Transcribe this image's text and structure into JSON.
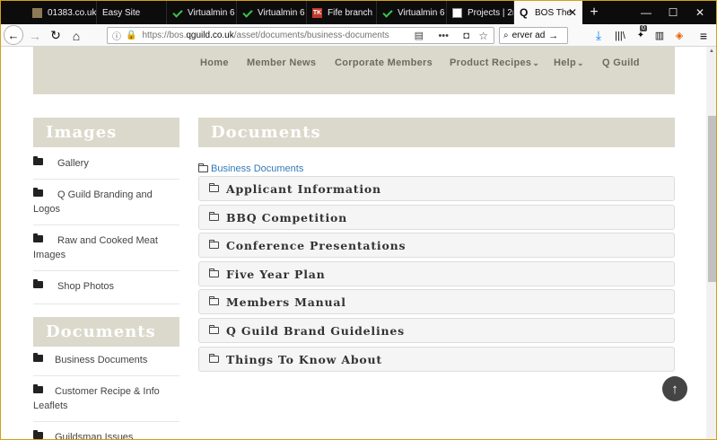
{
  "browser": {
    "tabs": [
      {
        "label": "01383.co.uk",
        "icon": "photo-icon"
      },
      {
        "label": "Easy Site",
        "icon": ""
      },
      {
        "label": "Virtualmin 6",
        "icon": "check-icon"
      },
      {
        "label": "Virtualmin 6",
        "icon": "check-icon"
      },
      {
        "label": "Fife branch",
        "icon": "tk-icon"
      },
      {
        "label": "Virtualmin 6",
        "icon": "check-icon"
      },
      {
        "label": "Projects | 2n",
        "icon": "projects-icon"
      },
      {
        "label": "BOS The",
        "icon": "q-icon"
      }
    ],
    "new_tab": "+",
    "url_prefix": "https://bos.",
    "url_host": "qguild.co.uk",
    "url_path": "/asset/documents/business-documents",
    "search_text": "erver ad",
    "toolbar_badge": "0",
    "tk_letters": "TK",
    "q_letter": "Q"
  },
  "site": {
    "menu": [
      {
        "label": "Home"
      },
      {
        "label": "Member News"
      },
      {
        "label": "Corporate Members"
      },
      {
        "label": "Product Recipes"
      },
      {
        "label": "Help"
      },
      {
        "label": "Q Guild"
      }
    ],
    "dropdown_marker": "⌄"
  },
  "sidebar": {
    "images": {
      "title": "Images",
      "items": [
        "Gallery",
        "Q Guild Branding and Logos",
        "Raw and Cooked Meat Images",
        "Shop Photos"
      ]
    },
    "documents": {
      "title": "Documents",
      "items": [
        "Business Documents",
        "Customer Recipe & Info Leaflets",
        "Guildsman Issues"
      ]
    }
  },
  "main": {
    "title": "Documents",
    "breadcrumb": "Business Documents",
    "folders": [
      "Applicant Information",
      "BBQ Competition",
      "Conference Presentations",
      "Five Year Plan",
      "Members Manual",
      "Q Guild Brand Guidelines",
      "Things To Know About"
    ]
  },
  "colors": {
    "header_bg": "#dbd9cb",
    "link": "#337ab7",
    "tab_bar": "#0c0c0d"
  }
}
